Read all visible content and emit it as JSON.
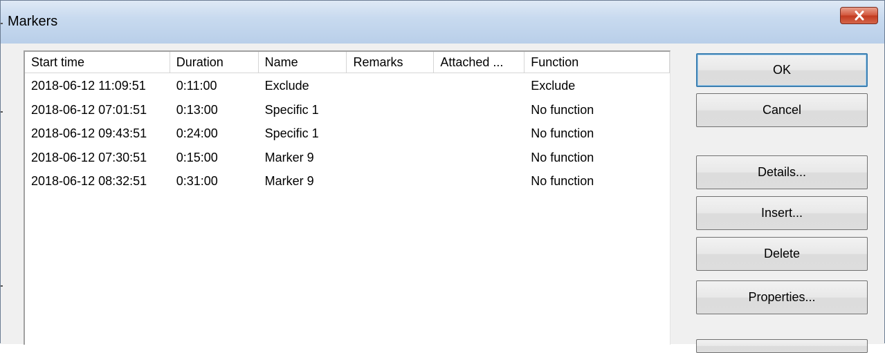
{
  "window": {
    "title": "Markers",
    "close_icon": "close-x-icon",
    "colors": {
      "titlebar": "#c8daef",
      "close_button": "#c94a2e",
      "default_button_border": "#3c7fb1"
    }
  },
  "table": {
    "columns": [
      "Start time",
      "Duration",
      "Name",
      "Remarks",
      "Attached ...",
      "Function"
    ],
    "rows": [
      {
        "start": "2018-06-12 11:09:51",
        "duration": "0:11:00",
        "name": "Exclude",
        "remarks": "",
        "attached": "",
        "function": "Exclude"
      },
      {
        "start": "2018-06-12 07:01:51",
        "duration": "0:13:00",
        "name": "Specific 1",
        "remarks": "",
        "attached": "",
        "function": "No function"
      },
      {
        "start": "2018-06-12 09:43:51",
        "duration": "0:24:00",
        "name": "Specific 1",
        "remarks": "",
        "attached": "",
        "function": "No function"
      },
      {
        "start": "2018-06-12 07:30:51",
        "duration": "0:15:00",
        "name": "Marker 9",
        "remarks": "",
        "attached": "",
        "function": "No function"
      },
      {
        "start": "2018-06-12 08:32:51",
        "duration": "0:31:00",
        "name": "Marker 9",
        "remarks": "",
        "attached": "",
        "function": "No function"
      }
    ]
  },
  "buttons": {
    "ok": "OK",
    "cancel": "Cancel",
    "details": "Details...",
    "insert": "Insert...",
    "delete": "Delete",
    "properties": "Properties..."
  }
}
